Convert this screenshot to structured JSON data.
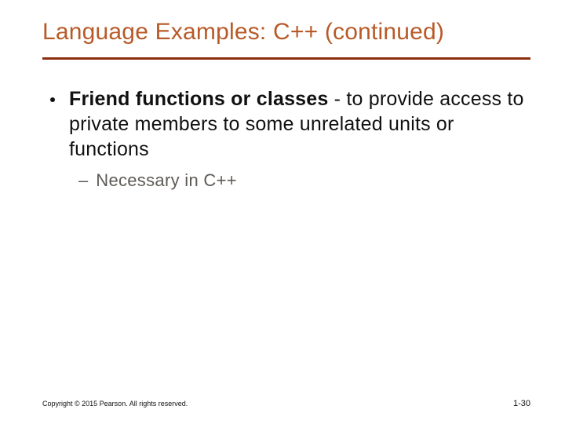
{
  "title": "Language Examples: C++ (continued)",
  "bullets": [
    {
      "bold": "Friend functions or classes",
      "rest": " - to provide access to private members to some unrelated units or functions",
      "sub": [
        {
          "text": "Necessary in C++"
        }
      ]
    }
  ],
  "footer": {
    "copyright": "Copyright © 2015 Pearson. All rights reserved.",
    "page": "1-30"
  }
}
